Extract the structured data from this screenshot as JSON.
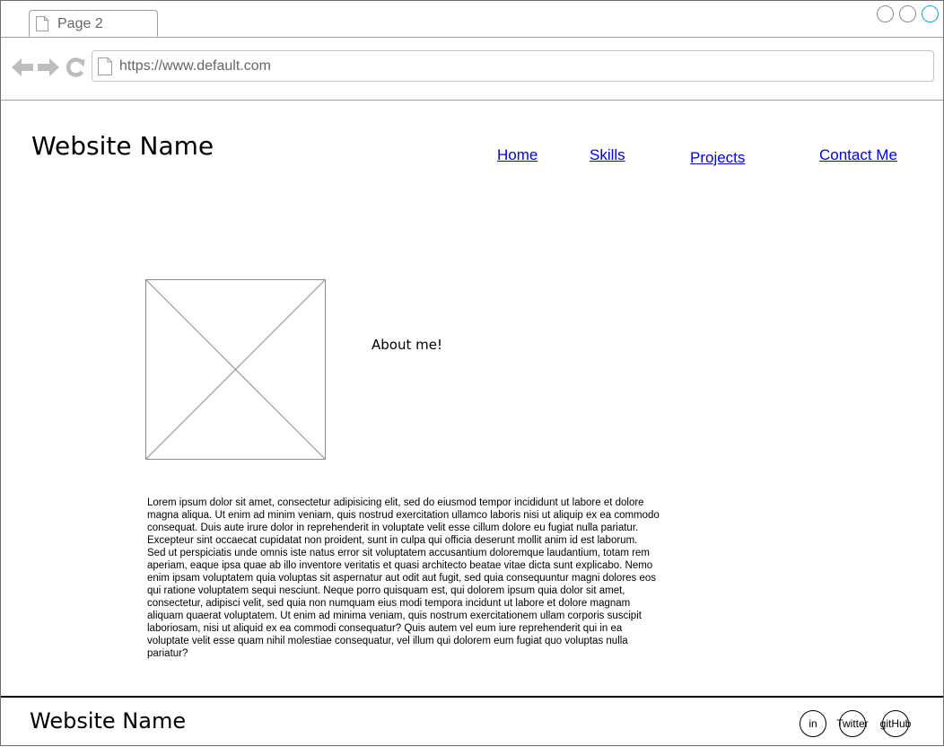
{
  "browser": {
    "tab_label": "Page 2",
    "url": "https://www.default.com",
    "accent_color": "#1ba1e2",
    "icons": [
      "page-icon",
      "back-arrow-icon",
      "forward-arrow-icon",
      "reload-icon"
    ]
  },
  "header": {
    "site_name": "Website Name",
    "nav": {
      "home": "Home",
      "skills": "Skills",
      "projects": "Projects",
      "contact": "Contact Me"
    },
    "link_color": "#0000ee"
  },
  "main": {
    "about_heading": "About me!",
    "body_text": "Lorem ipsum dolor sit amet, consectetur adipisicing elit, sed do eiusmod tempor incididunt ut labore et dolore magna aliqua. Ut enim ad minim veniam, quis nostrud exercitation ullamco laboris nisi ut aliquip ex ea commodo consequat. Duis aute irure dolor in reprehenderit in voluptate velit esse cillum dolore eu fugiat nulla pariatur. Excepteur sint occaecat cupidatat non proident, sunt in culpa qui officia deserunt mollit anim id est laborum.\nSed ut perspiciatis unde omnis iste natus error sit voluptatem accusantium doloremque laudantium, totam rem aperiam, eaque ipsa quae ab illo inventore veritatis et quasi architecto beatae vitae dicta sunt explicabo. Nemo enim ipsam voluptatem quia voluptas sit aspernatur aut odit aut fugit, sed quia consequuntur magni dolores eos qui ratione voluptatem sequi nesciunt. Neque porro quisquam est, qui dolorem ipsum quia dolor sit amet, consectetur, adipisci velit, sed quia non numquam eius modi tempora incidunt ut labore et dolore magnam aliquam quaerat voluptatem. Ut enim ad minima veniam, quis nostrum exercitationem ullam corporis suscipit laboriosam, nisi ut aliquid ex ea commodi consequatur? Quis autem vel eum iure reprehenderit qui in ea voluptate velit esse quam nihil molestiae consequatur, vel illum qui dolorem eum fugiat quo voluptas nulla pariatur?"
  },
  "footer": {
    "site_name": "Website Name",
    "social": {
      "linkedin": "in",
      "twitter": "Twitter",
      "github": "gitHub"
    }
  }
}
